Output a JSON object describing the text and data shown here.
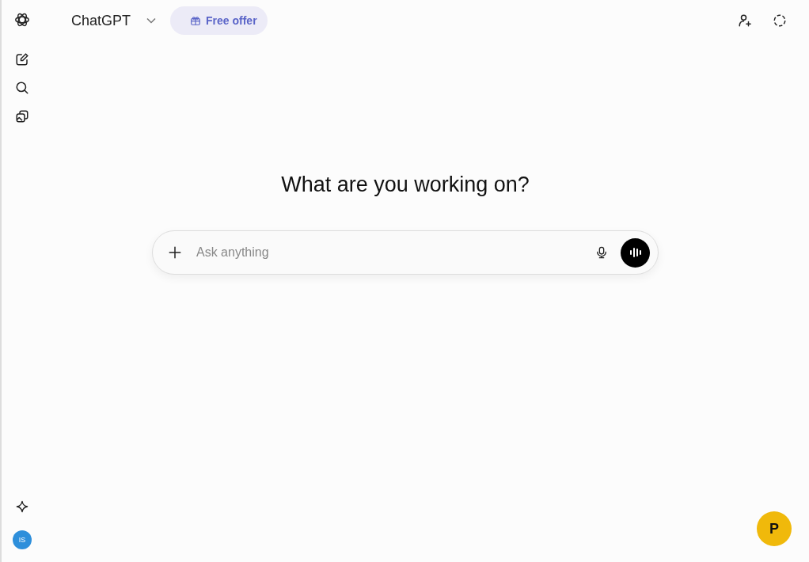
{
  "header": {
    "model": "ChatGPT",
    "offer": "Free offer"
  },
  "main": {
    "heading": "What are you working on?",
    "composer": {
      "placeholder": "Ask anything"
    }
  },
  "sidebar": {
    "avatar": "IS"
  },
  "floating_button": {
    "label": "P"
  }
}
